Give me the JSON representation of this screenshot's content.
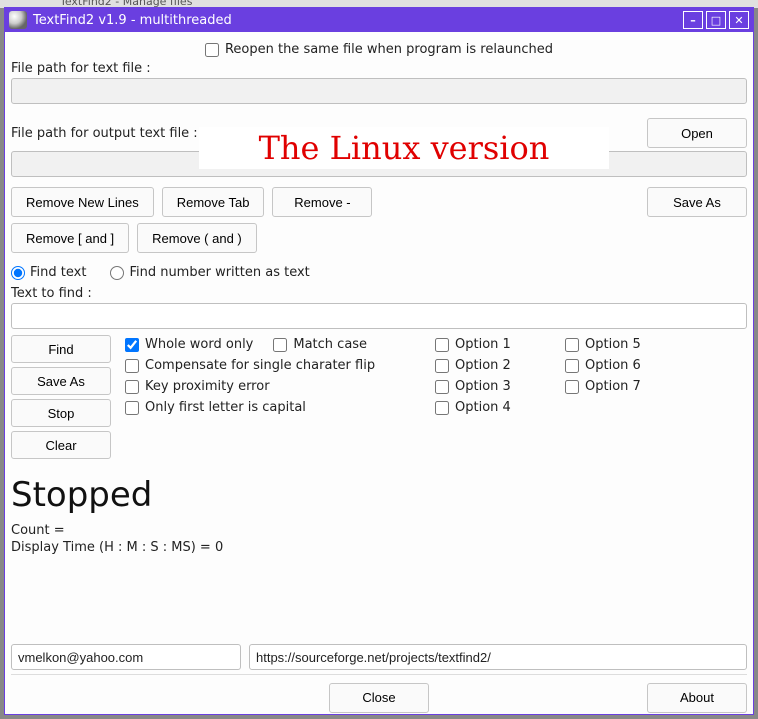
{
  "titlebar": {
    "title": "TextFind2 v1.9 - multithreaded"
  },
  "bg_tab_text": "TextFind2 - Manage files",
  "reopen": {
    "label": "Reopen the same file when program is relaunched",
    "checked": false
  },
  "labels": {
    "file_path_text": "File path for text file :",
    "file_path_output": "File path for output text file :",
    "text_to_find": "Text to find :"
  },
  "inputs": {
    "file_path_text": "",
    "file_path_output": "",
    "text_to_find": "",
    "contact": "vmelkon@yahoo.com",
    "url": "https://sourceforge.net/projects/textfind2/"
  },
  "buttons": {
    "open": "Open",
    "remove_newlines": "Remove New Lines",
    "remove_tab": "Remove Tab",
    "remove_dash": "Remove -",
    "save_as": "Save As",
    "remove_brackets": "Remove [ and ]",
    "remove_parens": "Remove ( and )",
    "find": "Find",
    "save_as2": "Save As",
    "stop": "Stop",
    "clear": "Clear",
    "close": "Close",
    "about": "About"
  },
  "radios": {
    "find_text": "Find text",
    "find_number": "Find number written as text",
    "selected": "find_text"
  },
  "checks": {
    "whole_word": {
      "label": "Whole word only",
      "checked": true
    },
    "match_case": {
      "label": "Match case",
      "checked": false
    },
    "compensate": {
      "label": "Compensate for single charater flip",
      "checked": false
    },
    "key_prox": {
      "label": "Key proximity error",
      "checked": false
    },
    "first_cap": {
      "label": "Only first letter is capital",
      "checked": false
    },
    "opt1": {
      "label": "Option 1",
      "checked": false
    },
    "opt2": {
      "label": "Option 2",
      "checked": false
    },
    "opt3": {
      "label": "Option 3",
      "checked": false
    },
    "opt4": {
      "label": "Option 4",
      "checked": false
    },
    "opt5": {
      "label": "Option 5",
      "checked": false
    },
    "opt6": {
      "label": "Option 6",
      "checked": false
    },
    "opt7": {
      "label": "Option 7",
      "checked": false
    }
  },
  "status": {
    "heading": "Stopped",
    "count": "Count =",
    "display_time": "Display Time (H : M : S : MS) = 0"
  },
  "annotation": "The Linux version"
}
